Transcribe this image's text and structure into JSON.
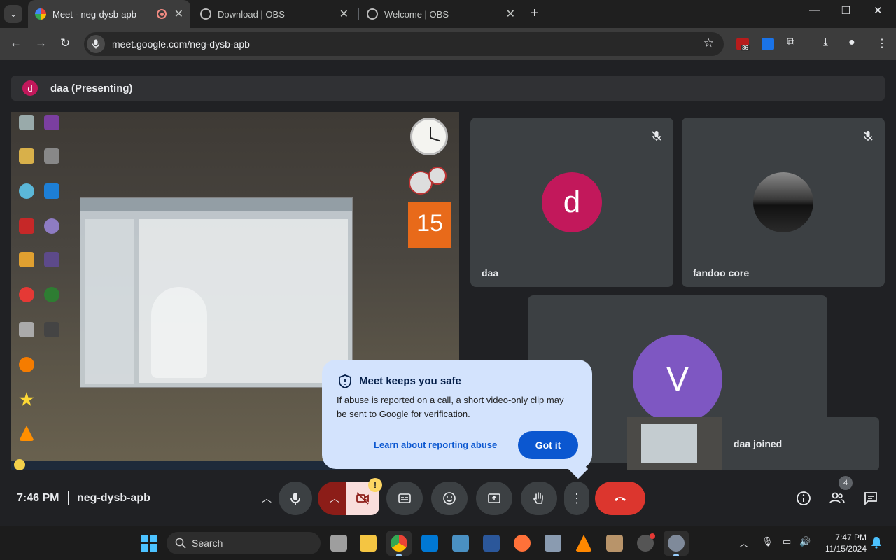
{
  "browser": {
    "tabs": [
      {
        "title": "Meet - neg-dysb-apb",
        "active": true
      },
      {
        "title": "Download | OBS",
        "active": false
      },
      {
        "title": "Welcome | OBS",
        "active": false
      }
    ],
    "url": "meet.google.com/neg-dysb-apb",
    "extension_badge": "36"
  },
  "meet": {
    "presenting_avatar": "d",
    "presenting_label": "daa (Presenting)",
    "tiles": [
      {
        "name": "daa",
        "avatar": "d",
        "muted": true,
        "color": "#c2185b"
      },
      {
        "name": "fandoo core",
        "avatar": "",
        "muted": true,
        "color": "#2a2a2a"
      },
      {
        "name": "",
        "avatar": "V",
        "muted": false,
        "color": "#7e57c2"
      }
    ],
    "join_toast": "daa joined",
    "calendar_day": "15",
    "safety": {
      "title": "Meet keeps you safe",
      "body": "If abuse is reported on a call, a short video-only clip may be sent to Google for verification.",
      "link": "Learn about reporting abuse",
      "button": "Got it"
    },
    "time": "7:46 PM",
    "meeting_code": "neg-dysb-apb",
    "camera_warning": "!",
    "participant_count": "4"
  },
  "taskbar": {
    "search_label": "Search",
    "clock_time": "7:47 PM",
    "clock_date": "11/15/2024"
  },
  "colors": {
    "accent": "#0b57d0",
    "leave": "#dc362e",
    "tooltip_bg": "#d3e3fd"
  }
}
